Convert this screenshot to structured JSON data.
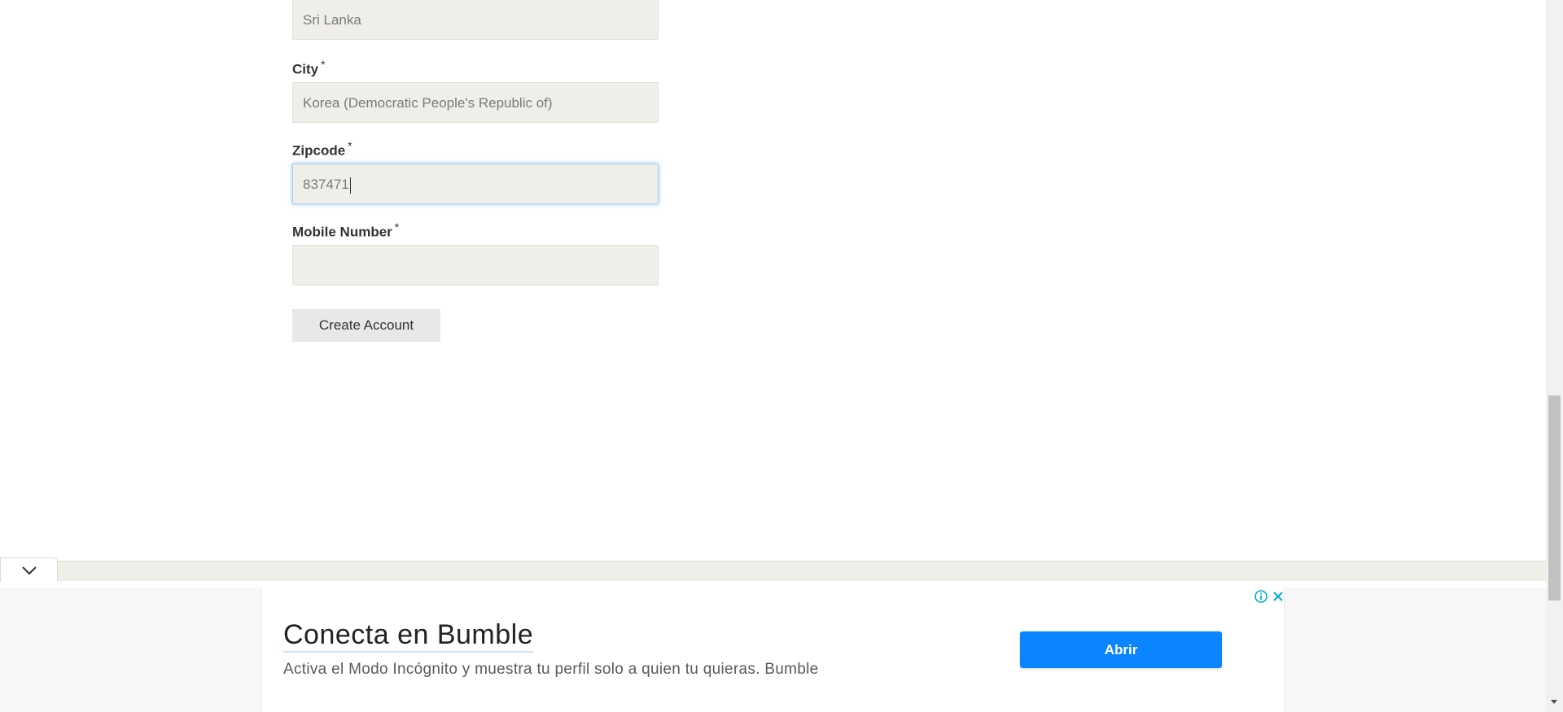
{
  "form": {
    "country_value": "Sri Lanka",
    "city": {
      "label": "City",
      "required_mark": "*",
      "value": "Korea (Democratic People's Republic of)"
    },
    "zipcode": {
      "label": "Zipcode",
      "required_mark": "*",
      "value": "837471"
    },
    "mobile": {
      "label": "Mobile Number",
      "required_mark": "*",
      "value": ""
    },
    "submit_label": "Create Account"
  },
  "ad": {
    "title": "Conecta en Bumble",
    "description": "Activa el Modo Incógnito y muestra tu perfil solo a quien tu quieras. Bumble",
    "button_label": "Abrir",
    "accent_color": "#0a84ff",
    "info_icon": "info-icon",
    "close_icon": "close-icon"
  },
  "collapse_toggle": {
    "icon": "chevron-down-icon"
  }
}
